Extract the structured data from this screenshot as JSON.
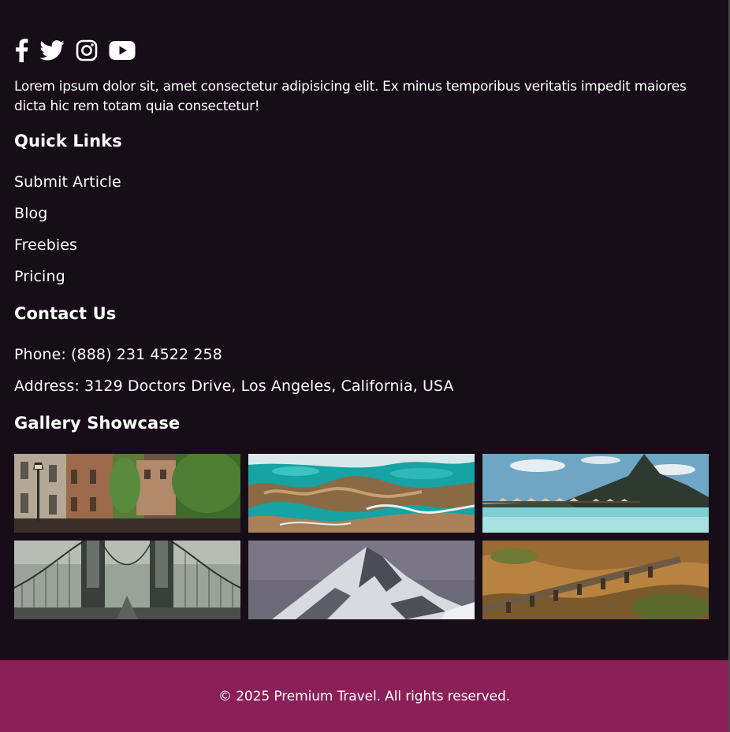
{
  "social": {
    "icons": [
      "facebook-icon",
      "twitter-icon",
      "instagram-icon",
      "youtube-icon"
    ]
  },
  "about": {
    "text": "Lorem ipsum dolor sit, amet consectetur adipisicing elit. Ex minus temporibus veritatis impedit maiores dicta hic rem totam quia consectetur!"
  },
  "quick_links": {
    "heading": "Quick Links",
    "items": [
      "Submit Article",
      "Blog",
      "Freebies",
      "Pricing"
    ]
  },
  "contact": {
    "heading": "Contact Us",
    "phone": "Phone: (888) 231 4522 258",
    "address": "Address: 3129 Doctors Drive, Los Angeles, California, USA"
  },
  "gallery": {
    "heading": "Gallery Showcase",
    "images": [
      "street-with-ivy-photo",
      "turquoise-coast-aerial-photo",
      "overwater-bungalows-photo",
      "suspension-bridge-photo",
      "snowy-mountain-peak-photo",
      "stone-aqueduct-photo"
    ]
  },
  "bottom_bar": {
    "copyright": "© 2025 Premium Travel. All rights reserved."
  },
  "colors": {
    "background": "#160d18",
    "bottom_bar": "#8b1f58",
    "text": "#ffffff"
  }
}
